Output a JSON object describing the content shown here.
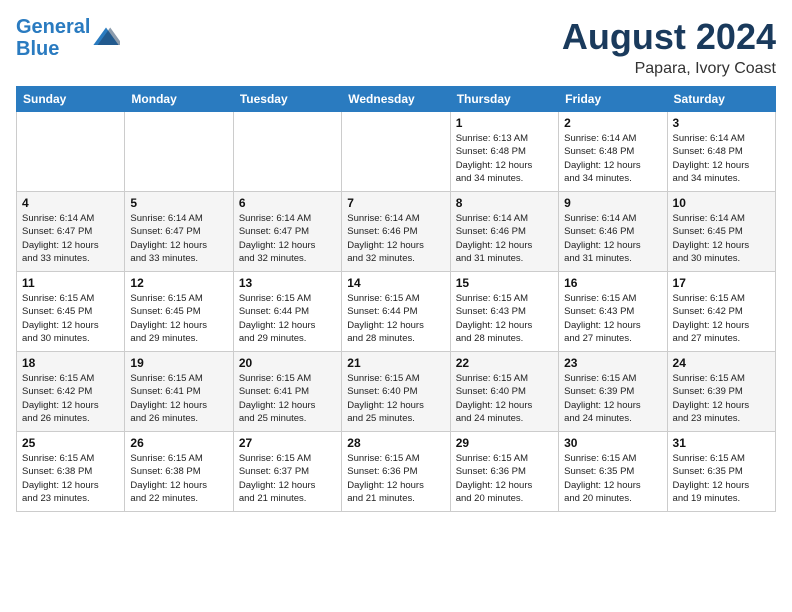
{
  "logo": {
    "line1": "General",
    "line2": "Blue"
  },
  "title": "August 2024",
  "subtitle": "Papara, Ivory Coast",
  "days_of_week": [
    "Sunday",
    "Monday",
    "Tuesday",
    "Wednesday",
    "Thursday",
    "Friday",
    "Saturday"
  ],
  "weeks": [
    [
      {
        "day": "",
        "info": ""
      },
      {
        "day": "",
        "info": ""
      },
      {
        "day": "",
        "info": ""
      },
      {
        "day": "",
        "info": ""
      },
      {
        "day": "1",
        "info": "Sunrise: 6:13 AM\nSunset: 6:48 PM\nDaylight: 12 hours\nand 34 minutes."
      },
      {
        "day": "2",
        "info": "Sunrise: 6:14 AM\nSunset: 6:48 PM\nDaylight: 12 hours\nand 34 minutes."
      },
      {
        "day": "3",
        "info": "Sunrise: 6:14 AM\nSunset: 6:48 PM\nDaylight: 12 hours\nand 34 minutes."
      }
    ],
    [
      {
        "day": "4",
        "info": "Sunrise: 6:14 AM\nSunset: 6:47 PM\nDaylight: 12 hours\nand 33 minutes."
      },
      {
        "day": "5",
        "info": "Sunrise: 6:14 AM\nSunset: 6:47 PM\nDaylight: 12 hours\nand 33 minutes."
      },
      {
        "day": "6",
        "info": "Sunrise: 6:14 AM\nSunset: 6:47 PM\nDaylight: 12 hours\nand 32 minutes."
      },
      {
        "day": "7",
        "info": "Sunrise: 6:14 AM\nSunset: 6:46 PM\nDaylight: 12 hours\nand 32 minutes."
      },
      {
        "day": "8",
        "info": "Sunrise: 6:14 AM\nSunset: 6:46 PM\nDaylight: 12 hours\nand 31 minutes."
      },
      {
        "day": "9",
        "info": "Sunrise: 6:14 AM\nSunset: 6:46 PM\nDaylight: 12 hours\nand 31 minutes."
      },
      {
        "day": "10",
        "info": "Sunrise: 6:14 AM\nSunset: 6:45 PM\nDaylight: 12 hours\nand 30 minutes."
      }
    ],
    [
      {
        "day": "11",
        "info": "Sunrise: 6:15 AM\nSunset: 6:45 PM\nDaylight: 12 hours\nand 30 minutes."
      },
      {
        "day": "12",
        "info": "Sunrise: 6:15 AM\nSunset: 6:45 PM\nDaylight: 12 hours\nand 29 minutes."
      },
      {
        "day": "13",
        "info": "Sunrise: 6:15 AM\nSunset: 6:44 PM\nDaylight: 12 hours\nand 29 minutes."
      },
      {
        "day": "14",
        "info": "Sunrise: 6:15 AM\nSunset: 6:44 PM\nDaylight: 12 hours\nand 28 minutes."
      },
      {
        "day": "15",
        "info": "Sunrise: 6:15 AM\nSunset: 6:43 PM\nDaylight: 12 hours\nand 28 minutes."
      },
      {
        "day": "16",
        "info": "Sunrise: 6:15 AM\nSunset: 6:43 PM\nDaylight: 12 hours\nand 27 minutes."
      },
      {
        "day": "17",
        "info": "Sunrise: 6:15 AM\nSunset: 6:42 PM\nDaylight: 12 hours\nand 27 minutes."
      }
    ],
    [
      {
        "day": "18",
        "info": "Sunrise: 6:15 AM\nSunset: 6:42 PM\nDaylight: 12 hours\nand 26 minutes."
      },
      {
        "day": "19",
        "info": "Sunrise: 6:15 AM\nSunset: 6:41 PM\nDaylight: 12 hours\nand 26 minutes."
      },
      {
        "day": "20",
        "info": "Sunrise: 6:15 AM\nSunset: 6:41 PM\nDaylight: 12 hours\nand 25 minutes."
      },
      {
        "day": "21",
        "info": "Sunrise: 6:15 AM\nSunset: 6:40 PM\nDaylight: 12 hours\nand 25 minutes."
      },
      {
        "day": "22",
        "info": "Sunrise: 6:15 AM\nSunset: 6:40 PM\nDaylight: 12 hours\nand 24 minutes."
      },
      {
        "day": "23",
        "info": "Sunrise: 6:15 AM\nSunset: 6:39 PM\nDaylight: 12 hours\nand 24 minutes."
      },
      {
        "day": "24",
        "info": "Sunrise: 6:15 AM\nSunset: 6:39 PM\nDaylight: 12 hours\nand 23 minutes."
      }
    ],
    [
      {
        "day": "25",
        "info": "Sunrise: 6:15 AM\nSunset: 6:38 PM\nDaylight: 12 hours\nand 23 minutes."
      },
      {
        "day": "26",
        "info": "Sunrise: 6:15 AM\nSunset: 6:38 PM\nDaylight: 12 hours\nand 22 minutes."
      },
      {
        "day": "27",
        "info": "Sunrise: 6:15 AM\nSunset: 6:37 PM\nDaylight: 12 hours\nand 21 minutes."
      },
      {
        "day": "28",
        "info": "Sunrise: 6:15 AM\nSunset: 6:36 PM\nDaylight: 12 hours\nand 21 minutes."
      },
      {
        "day": "29",
        "info": "Sunrise: 6:15 AM\nSunset: 6:36 PM\nDaylight: 12 hours\nand 20 minutes."
      },
      {
        "day": "30",
        "info": "Sunrise: 6:15 AM\nSunset: 6:35 PM\nDaylight: 12 hours\nand 20 minutes."
      },
      {
        "day": "31",
        "info": "Sunrise: 6:15 AM\nSunset: 6:35 PM\nDaylight: 12 hours\nand 19 minutes."
      }
    ]
  ]
}
